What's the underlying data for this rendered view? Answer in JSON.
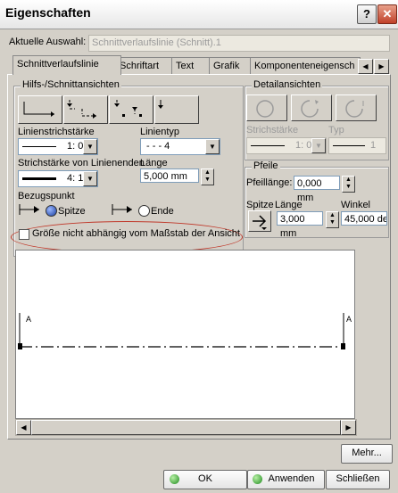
{
  "window": {
    "title": "Eigenschaften"
  },
  "selection": {
    "label": "Aktuelle Auswahl:",
    "value": "Schnittverlaufslinie (Schnitt).1"
  },
  "tabs": [
    {
      "label": "Schnittverlaufslinie"
    },
    {
      "label": "Schriftart"
    },
    {
      "label": "Text"
    },
    {
      "label": "Grafik"
    },
    {
      "label": "Komponenteneigensch"
    }
  ],
  "hilfs": {
    "title": "Hilfs-/Schnittansichten",
    "linienstrichstaerke_label": "Linienstrichstärke",
    "linienstrichstaerke_value": "1: 0",
    "linientyp_label": "Linientyp",
    "linientyp_value": "- - - 4",
    "strichstaerke_label": "Strichstärke von Linienenden",
    "strichstaerke_value": "4: 1",
    "laenge_label": "Länge",
    "laenge_value": "5,000 mm",
    "bezugspunkt_label": "Bezugspunkt",
    "spitze_label": "Spitze",
    "ende_label": "Ende"
  },
  "checkbox_label": "Größe nicht abhängig vom Maßstab der Ansicht",
  "detail": {
    "title": "Detailansichten",
    "strichstaerke_label": "Strichstärke",
    "strichstaerke_value": "1: 0",
    "typ_label": "Typ",
    "typ_value": "1"
  },
  "pfeile": {
    "title": "Pfeile",
    "pfeillaenge_label": "Pfeillänge:",
    "pfeillaenge_value": "0,000 mm",
    "spitze_label": "Spitze",
    "laenge_label": "Länge",
    "laenge_value": "3,000 mm",
    "winkel_label": "Winkel",
    "winkel_value": "45,000 de"
  },
  "preview": {
    "marker_left": "A",
    "marker_right": "A"
  },
  "buttons": {
    "mehr": "Mehr...",
    "ok": "OK",
    "anwenden": "Anwenden",
    "schliessen": "Schließen"
  }
}
